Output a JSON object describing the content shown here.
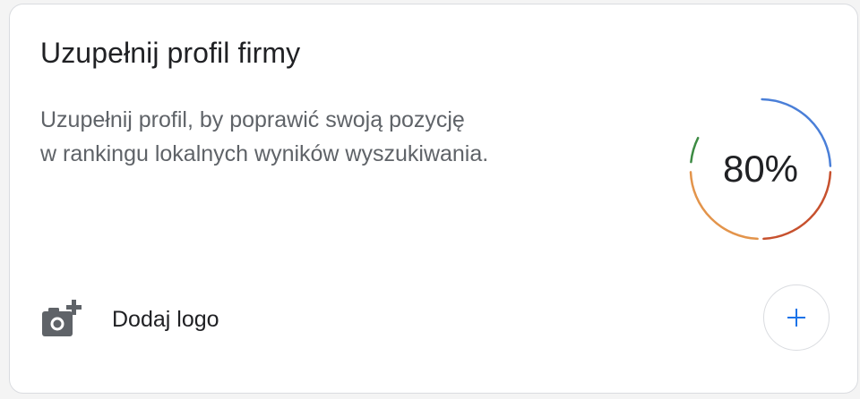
{
  "card": {
    "title": "Uzupełnij profil firmy",
    "description_lines": [
      "Uzupełnij profil, by poprawić swoją pozycję",
      "w rankingu lokalnych wyników wyszukiwania."
    ],
    "progress": {
      "value_label": "80%",
      "fraction": 0.8,
      "colors": [
        "#4285f4",
        "#ea4335",
        "#fbbc04",
        "#34a853"
      ]
    },
    "task": {
      "label": "Dodaj logo",
      "icon": "add-photo-icon",
      "action_icon": "plus-icon"
    }
  }
}
